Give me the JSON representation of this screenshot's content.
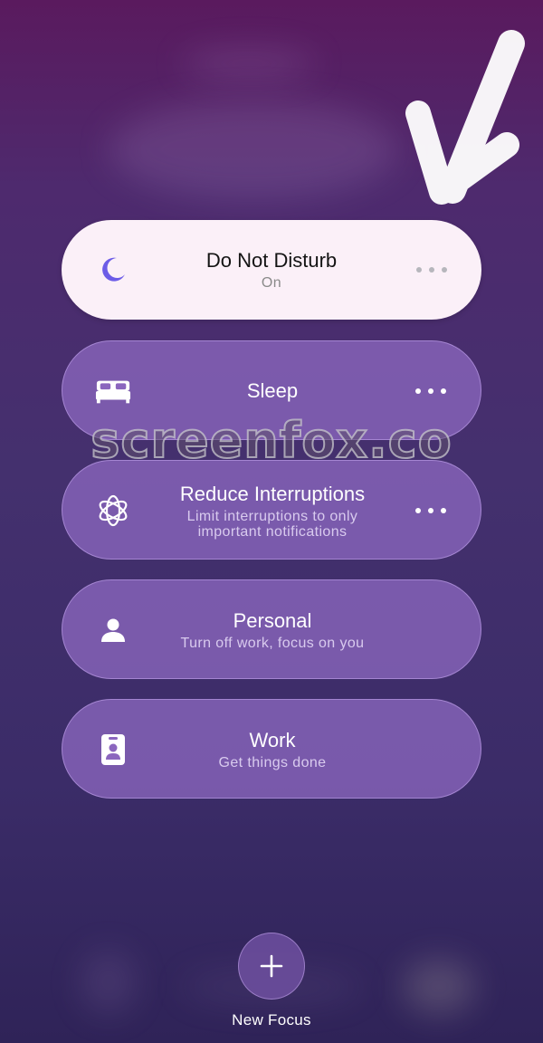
{
  "focus_modes": [
    {
      "title": "Do Not Disturb",
      "subtitle": "On",
      "icon": "moon-icon",
      "active": true,
      "has_more": true
    },
    {
      "title": "Sleep",
      "subtitle": "",
      "icon": "bed-icon",
      "active": false,
      "has_more": true
    },
    {
      "title": "Reduce Interruptions",
      "subtitle_line1": "Limit interruptions to only",
      "subtitle_line2": "important notifications",
      "icon": "flower-icon",
      "active": false,
      "has_more": true
    },
    {
      "title": "Personal",
      "subtitle": "Turn off work, focus on you",
      "icon": "person-icon",
      "active": false,
      "has_more": false
    },
    {
      "title": "Work",
      "subtitle": "Get things done",
      "icon": "id-badge-icon",
      "active": false,
      "has_more": false
    }
  ],
  "new_focus": {
    "label": "New Focus",
    "icon": "plus-icon"
  },
  "watermark": "screenfox.co",
  "colors": {
    "active_card": "#fbf0f8",
    "inactive_card": "#8b66be",
    "moon_accent": "#6c5ce7",
    "background_top": "#5a1a5e",
    "background_bottom": "#2f2358"
  }
}
